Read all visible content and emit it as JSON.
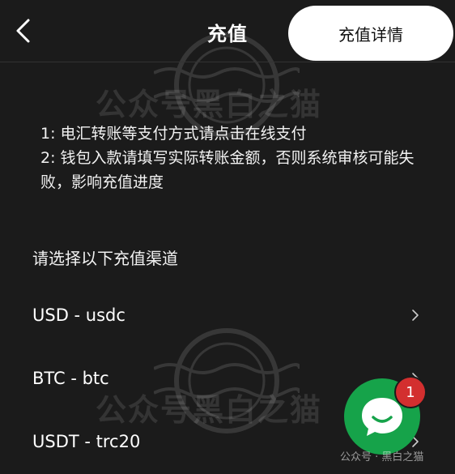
{
  "header": {
    "title": "充值",
    "details_button": "充值详情",
    "back_icon": "chevron-left-icon"
  },
  "watermark": {
    "text": "公众号黑白之猫"
  },
  "notice": {
    "line1": "1: 电汇转账等支付方式请点击在线支付",
    "line2": "2: 钱包入款请填写实际转账金额，否则系统审核可能失败，影响充值进度"
  },
  "channels": {
    "section_label": "请选择以下充值渠道",
    "items": [
      {
        "label": "USD - usdc"
      },
      {
        "label": "BTC - btc"
      },
      {
        "label": "USDT - trc20"
      }
    ]
  },
  "chat": {
    "icon": "chat-bubble-icon",
    "badge_count": "1",
    "color": "#16a34a"
  },
  "footer": {
    "credit": "公众号 · 黑白之猫"
  }
}
